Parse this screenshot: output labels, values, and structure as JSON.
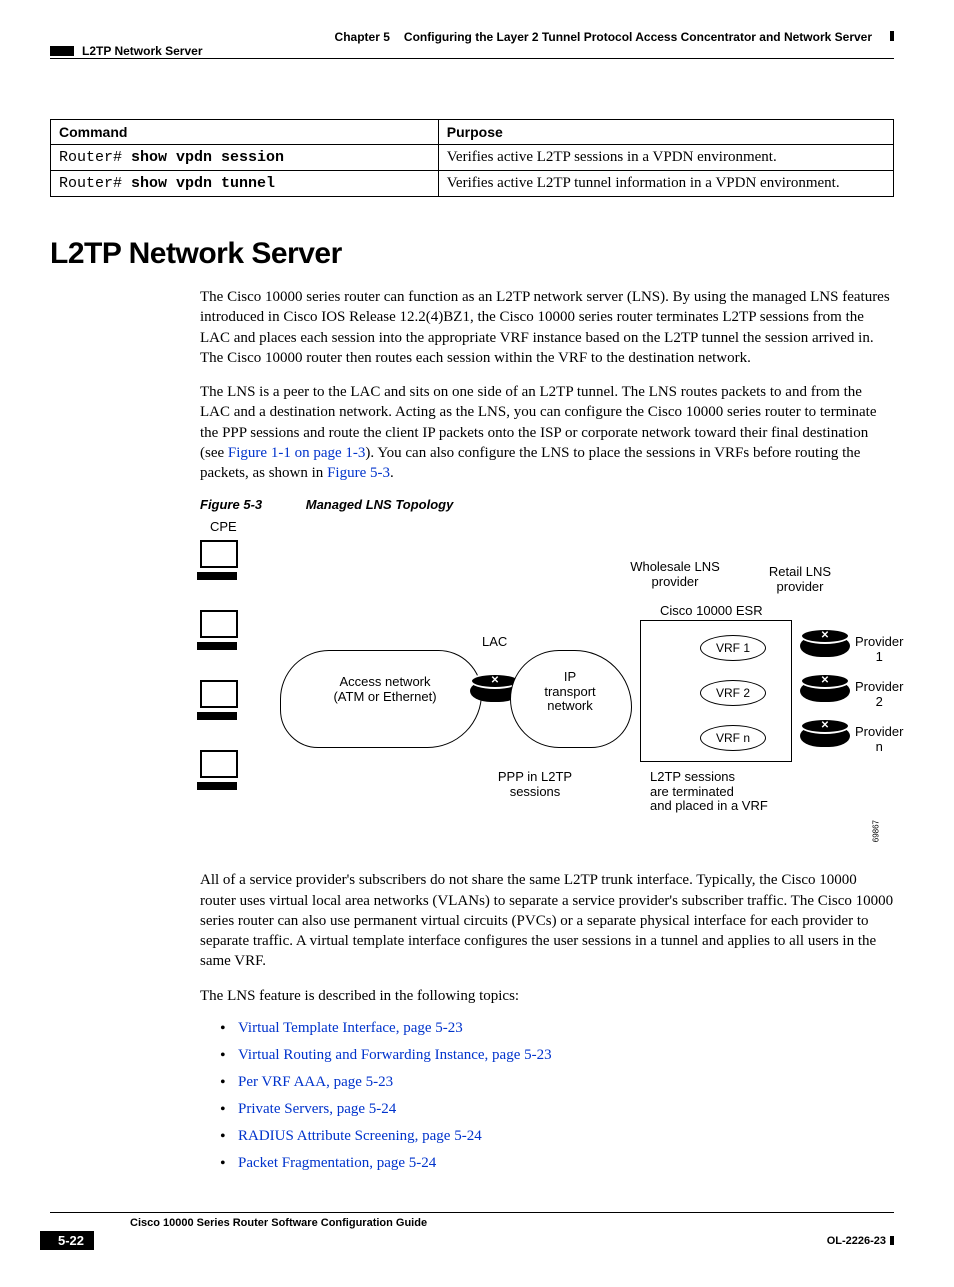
{
  "header": {
    "chapter_label": "Chapter 5",
    "chapter_title": "Configuring the Layer 2 Tunnel Protocol Access Concentrator and Network Server",
    "section_breadcrumb": "L2TP Network Server"
  },
  "table": {
    "headers": {
      "command": "Command",
      "purpose": "Purpose"
    },
    "rows": [
      {
        "prompt": "Router# ",
        "cmd": "show vpdn session",
        "purpose": "Verifies active L2TP sessions in a VPDN environment."
      },
      {
        "prompt": "Router# ",
        "cmd": "show vpdn tunnel",
        "purpose": "Verifies active L2TP tunnel information in a VPDN environment."
      }
    ]
  },
  "heading": "L2TP Network Server",
  "paragraphs": {
    "p1": "The Cisco 10000 series router can function as an L2TP network server (LNS). By using the managed LNS features introduced in Cisco IOS Release 12.2(4)BZ1, the Cisco 10000 series router terminates L2TP sessions from the LAC and places each session into the appropriate VRF instance based on the L2TP tunnel the session arrived in. The Cisco 10000 router then routes each session within the VRF to the destination network.",
    "p2_pre": "The LNS is a peer to the LAC and sits on one side of an L2TP tunnel. The LNS routes packets to and from the LAC and a destination network. Acting as the LNS, you can configure the Cisco 10000 series router to terminate the PPP sessions and route the client IP packets onto the ISP or corporate network toward their final destination (see ",
    "p2_link1": "Figure 1-1 on page 1-3",
    "p2_mid": "). You can also configure the LNS to place the sessions in VRFs before routing the packets, as shown in ",
    "p2_link2": "Figure 5-3",
    "p2_end": ".",
    "p3": "All of a service provider's subscribers do not share the same L2TP trunk interface. Typically, the Cisco 10000 router uses virtual local area networks (VLANs) to separate a service provider's subscriber traffic. The Cisco 10000 series router can also use permanent virtual circuits (PVCs) or a separate physical interface for each provider to separate traffic. A virtual template interface configures the user sessions in a tunnel and applies to all users in the same VRF.",
    "p4": "The LNS feature is described in the following topics:"
  },
  "figure": {
    "label": "Figure 5-3",
    "title": "Managed LNS Topology",
    "labels": {
      "cpe": "CPE",
      "access_net_l1": "Access network",
      "access_net_l2": "(ATM or Ethernet)",
      "lac": "LAC",
      "ip_l1": "IP",
      "ip_l2": "transport",
      "ip_l3": "network",
      "ppp_l1": "PPP in L2TP",
      "ppp_l2": "sessions",
      "wholesale_l1": "Wholesale LNS",
      "wholesale_l2": "provider",
      "esr": "Cisco 10000 ESR",
      "vrf1": "VRF 1",
      "vrf2": "VRF 2",
      "vrfn": "VRF n",
      "retail_l1": "Retail LNS",
      "retail_l2": "provider",
      "prov1": "Provider 1",
      "prov2": "Provider 2",
      "provn": "Provider n",
      "term_l1": "L2TP sessions",
      "term_l2": "are terminated",
      "term_l3": "and placed in a VRF",
      "diagram_id": "69867"
    }
  },
  "topics": [
    "Virtual Template Interface, page 5-23",
    "Virtual Routing and Forwarding Instance, page 5-23",
    "Per VRF AAA, page 5-23",
    "Private Servers, page 5-24",
    "RADIUS Attribute Screening, page 5-24",
    "Packet Fragmentation, page 5-24"
  ],
  "footer": {
    "guide_title": "Cisco 10000 Series Router Software Configuration Guide",
    "page_number": "5-22",
    "doc_id": "OL-2226-23"
  }
}
